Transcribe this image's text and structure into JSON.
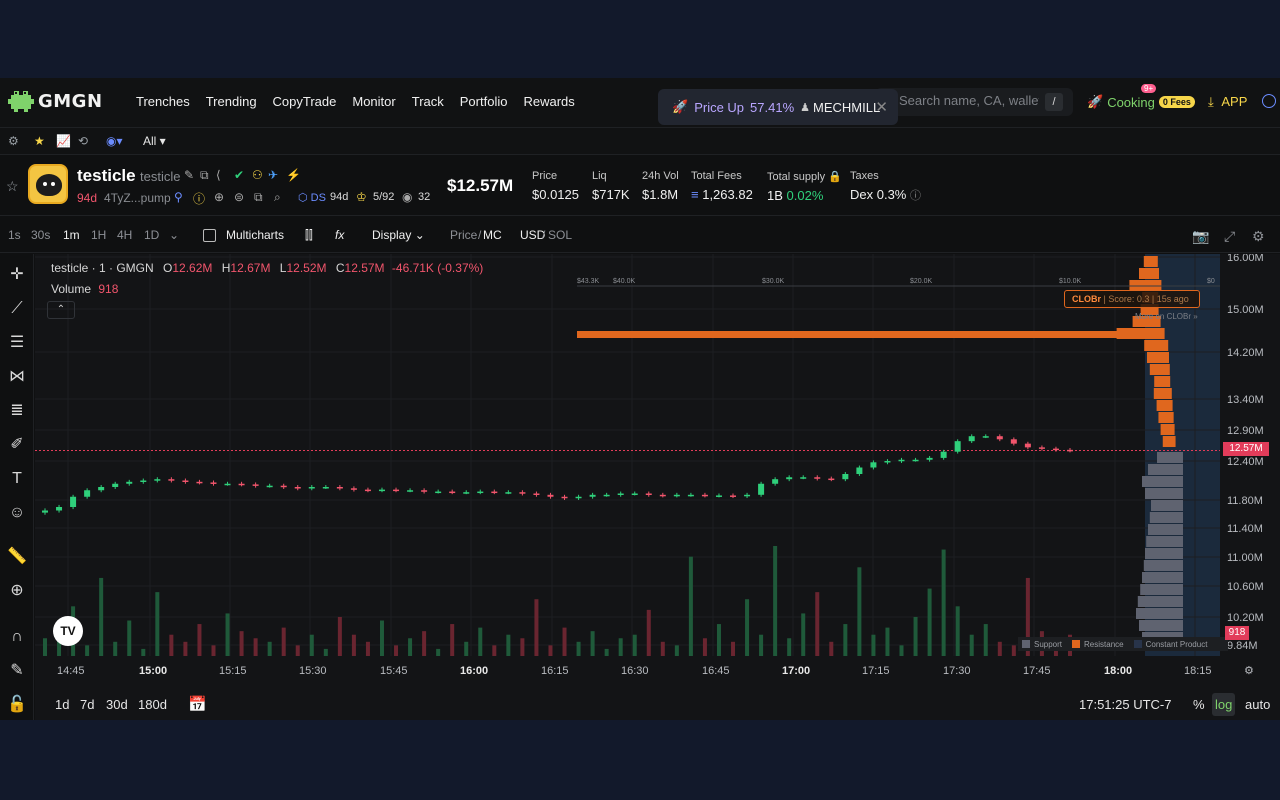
{
  "nav": {
    "logo": "GMGN",
    "links": [
      "Trenches",
      "Trending",
      "CopyTrade",
      "Monitor",
      "Track",
      "Portfolio",
      "Rewards"
    ],
    "toast": {
      "label": "Price Up",
      "value": "57.41%",
      "token": "MECHMILL"
    },
    "search_placeholder": "Search name, CA, wallet",
    "search_shortcut": "/",
    "cooking_label": "Cooking",
    "cooking_badge": "9+",
    "fees_badge": "0 Fees",
    "app_label": "APP"
  },
  "subbar": {
    "filter_label": "All"
  },
  "token": {
    "name": "testicle",
    "symbol": "testicle",
    "age": "94d",
    "ca": "4TyZ...pump",
    "ds_label": "DS",
    "ds_age": "94d",
    "holders_ratio": "5/92",
    "watchers": "32",
    "market_cap": "$12.57M",
    "stats": [
      {
        "label": "Price",
        "value": "$0.0125"
      },
      {
        "label": "Liq",
        "value": "$717K"
      },
      {
        "label": "24h Vol",
        "value": "$1.8M"
      },
      {
        "label": "Total Fees",
        "value": "1,263.82"
      },
      {
        "label": "Total supply",
        "value": "1B",
        "extra": "0.02%"
      },
      {
        "label": "Taxes",
        "value": "Dex 0.3%"
      }
    ]
  },
  "toolbar": {
    "timeframes": [
      "1s",
      "30s",
      "1m",
      "1H",
      "4H",
      "1D"
    ],
    "active_timeframe": "1m",
    "multicharts": "Multicharts",
    "display": "Display",
    "price_mc_a": "Price",
    "price_mc_b": "MC",
    "usd_sol_a": "USD",
    "usd_sol_b": "SOL"
  },
  "legend": {
    "title": "testicle · 1 · GMGN",
    "o_label": "O",
    "o": "12.62M",
    "h_label": "H",
    "h": "12.67M",
    "l_label": "L",
    "l": "12.52M",
    "c_label": "C",
    "c": "12.57M",
    "change": "-46.71K (-0.37%)",
    "volume_label": "Volume",
    "volume": "918"
  },
  "clob": {
    "badge": "CLOBr",
    "score": "| Score: 0.3 | 15s ago",
    "more": "More on CLOBr »",
    "depth_labels": [
      "$43.3K",
      "$40.0K",
      "$30.0K",
      "$20.0K",
      "$10.0K",
      "$0"
    ],
    "legend": [
      "Support",
      "Resistance",
      "Constant Product"
    ]
  },
  "chart_data": {
    "type": "candlestick",
    "y_axis_labels": [
      "16.00M",
      "15.00M",
      "14.20M",
      "13.40M",
      "12.90M",
      "12.40M",
      "11.80M",
      "11.40M",
      "11.00M",
      "10.60M",
      "10.20M",
      "9.84M"
    ],
    "x_axis_labels": [
      "14:45",
      "15:00",
      "15:15",
      "15:30",
      "15:45",
      "16:00",
      "16:15",
      "16:30",
      "16:45",
      "17:00",
      "17:15",
      "17:30",
      "17:45",
      "18:00",
      "18:15"
    ],
    "bold_x_labels": [
      "15:00",
      "16:00",
      "17:00",
      "18:00"
    ],
    "last_price": "12.57M",
    "last_volume": "918",
    "close_series": [
      11.65,
      11.7,
      11.85,
      11.95,
      12.0,
      12.05,
      12.08,
      12.1,
      12.12,
      12.1,
      12.08,
      12.07,
      12.05,
      12.05,
      12.04,
      12.02,
      12.02,
      12.0,
      11.98,
      12.0,
      12.0,
      11.98,
      11.96,
      11.95,
      11.96,
      11.95,
      11.95,
      11.93,
      11.93,
      11.92,
      11.92,
      11.93,
      11.92,
      11.92,
      11.9,
      11.88,
      11.85,
      11.83,
      11.85,
      11.88,
      11.88,
      11.9,
      11.9,
      11.88,
      11.87,
      11.88,
      11.88,
      11.87,
      11.87,
      11.86,
      11.88,
      12.05,
      12.12,
      12.15,
      12.15,
      12.13,
      12.12,
      12.2,
      12.3,
      12.38,
      12.4,
      12.42,
      12.42,
      12.45,
      12.55,
      12.72,
      12.8,
      12.8,
      12.75,
      12.68,
      12.62,
      12.6,
      12.58,
      12.57
    ],
    "volume_series": [
      5,
      8,
      14,
      3,
      22,
      4,
      10,
      2,
      18,
      6,
      4,
      9,
      3,
      12,
      7,
      5,
      4,
      8,
      3,
      6,
      2,
      11,
      6,
      4,
      10,
      3,
      5,
      7,
      2,
      9,
      4,
      8,
      3,
      6,
      5,
      16,
      3,
      8,
      4,
      7,
      2,
      5,
      6,
      13,
      4,
      3,
      28,
      5,
      9,
      4,
      16,
      6,
      31,
      5,
      12,
      18,
      4,
      9,
      25,
      6,
      8,
      3,
      11,
      19,
      30,
      14,
      6,
      9,
      4,
      3,
      22,
      7,
      5,
      6
    ],
    "depth_resistance": [
      0.15,
      0.3,
      0.6,
      0.2,
      0.25,
      0.5,
      1.0,
      0.4,
      0.35,
      0.3,
      0.2,
      0.25,
      0.2,
      0.18,
      0.15,
      0.12
    ],
    "depth_support": [
      0.1,
      0.25,
      0.35,
      0.3,
      0.2,
      0.22,
      0.25,
      0.28,
      0.3,
      0.32,
      0.35,
      0.38,
      0.42,
      0.45,
      0.4,
      0.35
    ]
  },
  "bottom": {
    "ranges": [
      "1d",
      "7d",
      "30d",
      "180d"
    ],
    "clock": "17:51:25 UTC-7",
    "pct": "%",
    "log": "log",
    "auto": "auto"
  }
}
